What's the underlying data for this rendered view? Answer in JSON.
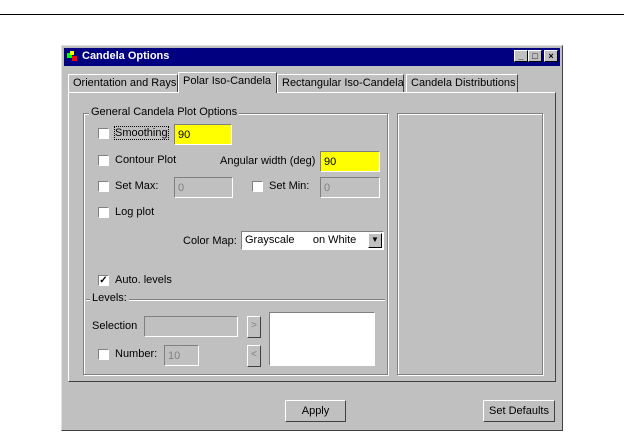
{
  "window": {
    "title": "Candela Options",
    "controls": [
      "_",
      "□",
      "×"
    ]
  },
  "tabs": [
    {
      "label": "Orientation and Rays",
      "active": false
    },
    {
      "label": "Polar Iso-Candela",
      "active": true
    },
    {
      "label": "Rectangular Iso-Candela",
      "active": false
    },
    {
      "label": "Candela Distributions",
      "active": false
    }
  ],
  "group": {
    "title": "General Candela Plot Options",
    "smoothing": {
      "label": "Smoothing",
      "checked": false,
      "value": "90"
    },
    "contour": {
      "label": "Contour Plot",
      "checked": false
    },
    "angular": {
      "label": "Angular width (deg)",
      "value": "90"
    },
    "set_max": {
      "label": "Set Max:",
      "checked": false,
      "value": "0"
    },
    "set_min": {
      "label": "Set Min:",
      "checked": false,
      "value": "0"
    },
    "log_plot": {
      "label": "Log plot",
      "checked": false
    },
    "color_map": {
      "label": "Color Map:",
      "value": "Grayscale      on White"
    },
    "auto_levels": {
      "label": "Auto. levels",
      "checked": true
    }
  },
  "levels": {
    "title": "Levels:",
    "selection_label": "Selection",
    "add_button": ">",
    "remove_button": "<",
    "number_label": "Number:",
    "number_checked": false,
    "number_value": "10"
  },
  "buttons": {
    "apply": "Apply",
    "set_defaults": "Set Defaults"
  },
  "colors": {
    "title_bar": "#000080",
    "field_highlight": "#ffff00",
    "face": "#c0c0c0"
  }
}
